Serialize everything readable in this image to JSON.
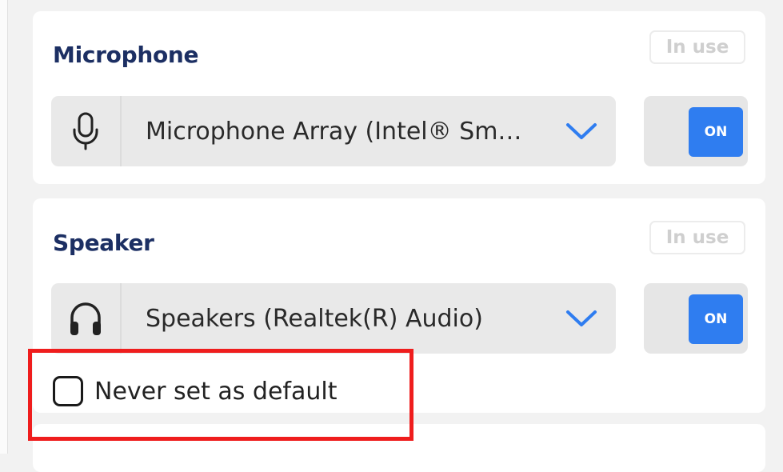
{
  "microphone": {
    "title": "Microphone",
    "status_badge": "In use",
    "icon": "microphone-icon",
    "device": "Microphone Array (Intel® Sm…",
    "toggle": "ON"
  },
  "speaker": {
    "title": "Speaker",
    "status_badge": "In use",
    "icon": "headphones-icon",
    "device": "Speakers (Realtek(R) Audio)",
    "toggle": "ON",
    "never_default_label": "Never set as default",
    "never_default_checked": false
  },
  "colors": {
    "accent": "#2f7df0",
    "title": "#1c2f63",
    "highlight": "#ef1d1d"
  }
}
